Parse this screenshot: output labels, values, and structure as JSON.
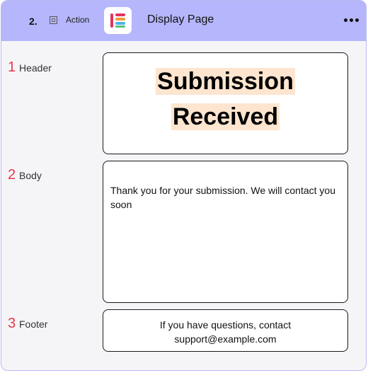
{
  "toolbar": {
    "step_number": "2.",
    "action_label": "Action",
    "app_title": "Display Page",
    "app_icon": "elementor-logo-icon",
    "more_icon": "more-horizontal-icon"
  },
  "sections": [
    {
      "number": "1",
      "label": "Header"
    },
    {
      "number": "2",
      "label": "Body"
    },
    {
      "number": "3",
      "label": "Footer"
    }
  ],
  "content": {
    "header_line1": "Submission",
    "header_line2": "Received",
    "body_text": "Thank you for your submission. We will contact you soon",
    "footer_text": "If you have questions, contact support@example.com"
  },
  "colors": {
    "header_bar": "#b5b6fb",
    "section_number": "#e8364a",
    "highlight": "#fde5cf"
  }
}
